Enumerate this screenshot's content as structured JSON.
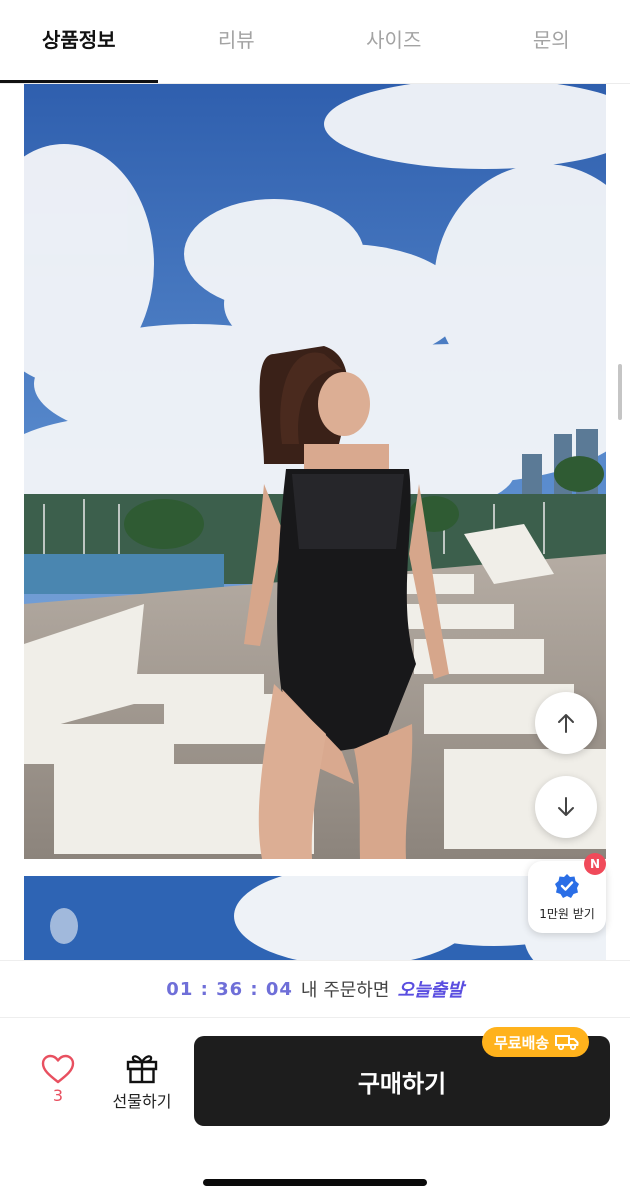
{
  "tabs": [
    {
      "label": "상품정보",
      "active": true
    },
    {
      "label": "리뷰",
      "active": false
    },
    {
      "label": "사이즈",
      "active": false
    },
    {
      "label": "문의",
      "active": false
    }
  ],
  "floating": {
    "up_icon": "arrow-up-icon",
    "down_icon": "arrow-down-icon",
    "coupon_icon": "verified-badge-icon",
    "coupon_label": "1만원 받기",
    "coupon_badge": "N"
  },
  "countdown": {
    "time": "01 : 36 : 04",
    "middle": "내 주문하면",
    "highlight": "오늘출발"
  },
  "actions": {
    "like_icon": "heart-icon",
    "like_count": "3",
    "gift_icon": "gift-icon",
    "gift_label": "선물하기",
    "buy_label": "구매하기",
    "shipping_tag": "무료배송",
    "shipping_icon": "truck-icon"
  },
  "colors": {
    "accent_purple": "#5a4ee0",
    "heart_red": "#e85060",
    "shipping_orange": "#ffb21c",
    "buy_black": "#1d1d1d"
  }
}
